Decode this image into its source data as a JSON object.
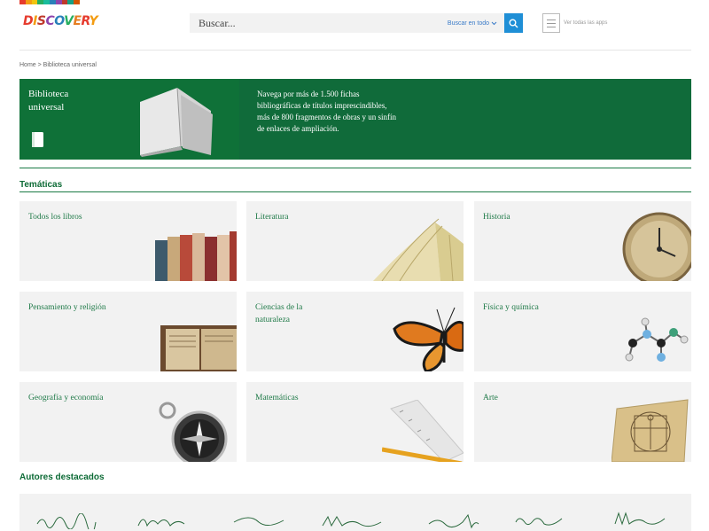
{
  "header": {
    "logo": "DISCOVERY",
    "search_placeholder": "Buscar...",
    "scope_label": "Buscar en todo",
    "apps_label": "Ver todas las apps"
  },
  "breadcrumb": "Home > Biblioteca universal",
  "hero": {
    "title": "Biblioteca universal",
    "description": "Navega por más de 1.500 fichas bibliográficas de títulos imprescindibles, más de 800 fragmentos de obras y un sinfín de enlaces de ampliación."
  },
  "sections": {
    "tematicas": "Temáticas",
    "autores": "Autores destacados"
  },
  "categories": [
    {
      "label": "Todos los libros",
      "icon": "books-icon"
    },
    {
      "label": "Literatura",
      "icon": "open-book-icon"
    },
    {
      "label": "Historia",
      "icon": "clock-icon"
    },
    {
      "label": "Pensamiento y religión",
      "icon": "old-book-icon"
    },
    {
      "label": "Ciencias de la naturaleza",
      "icon": "butterfly-icon"
    },
    {
      "label": "Física y química",
      "icon": "molecule-icon"
    },
    {
      "label": "Geografía y economía",
      "icon": "compass-icon"
    },
    {
      "label": "Matemáticas",
      "icon": "ruler-pencil-icon"
    },
    {
      "label": "Arte",
      "icon": "vitruvian-icon"
    }
  ],
  "colors": {
    "brand_green": "#0f7138",
    "accent_blue": "#1f8fd6",
    "card_bg": "#f2f2f2"
  }
}
